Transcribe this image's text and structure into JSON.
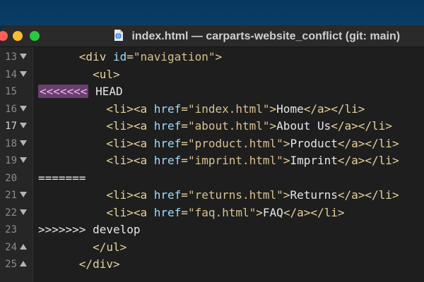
{
  "window": {
    "title": "index.html — carparts-website_conflict (git: main)"
  },
  "editor": {
    "active_line": 17,
    "lines": [
      {
        "n": "13",
        "fold": "down",
        "indent": "      ",
        "tokens": [
          [
            "t",
            "<div "
          ],
          [
            "a",
            "id"
          ],
          [
            "t",
            "="
          ],
          [
            "s",
            "\"navigation\""
          ],
          [
            "t",
            ">"
          ]
        ]
      },
      {
        "n": "14",
        "fold": "down",
        "indent": "        ",
        "tokens": [
          [
            "t",
            "<ul>"
          ]
        ]
      },
      {
        "n": "15",
        "fold": "",
        "indent": "",
        "tokens": [
          [
            "mk",
            "<<<<<<<"
          ],
          [
            "n",
            " HEAD"
          ]
        ]
      },
      {
        "n": "16",
        "fold": "down",
        "indent": "          ",
        "tokens": [
          [
            "t",
            "<li>"
          ],
          [
            "t",
            "<a "
          ],
          [
            "a",
            "href"
          ],
          [
            "t",
            "="
          ],
          [
            "s",
            "\"index.html\""
          ],
          [
            "t",
            ">"
          ],
          [
            "n",
            "Home"
          ],
          [
            "t",
            "</a>"
          ],
          [
            "t",
            "</li>"
          ]
        ]
      },
      {
        "n": "17",
        "fold": "down",
        "indent": "          ",
        "tokens": [
          [
            "t",
            "<li>"
          ],
          [
            "t",
            "<a "
          ],
          [
            "a",
            "href"
          ],
          [
            "t",
            "="
          ],
          [
            "s",
            "\"about.html\""
          ],
          [
            "t",
            ">"
          ],
          [
            "n",
            "About Us"
          ],
          [
            "t",
            "</a>"
          ],
          [
            "t",
            "</li>"
          ]
        ]
      },
      {
        "n": "18",
        "fold": "down",
        "indent": "          ",
        "tokens": [
          [
            "t",
            "<li>"
          ],
          [
            "t",
            "<a "
          ],
          [
            "a",
            "href"
          ],
          [
            "t",
            "="
          ],
          [
            "s",
            "\"product.html\""
          ],
          [
            "t",
            ">"
          ],
          [
            "n",
            "Product"
          ],
          [
            "t",
            "</a>"
          ],
          [
            "t",
            "</li>"
          ]
        ]
      },
      {
        "n": "19",
        "fold": "down",
        "indent": "          ",
        "tokens": [
          [
            "t",
            "<li>"
          ],
          [
            "t",
            "<a "
          ],
          [
            "a",
            "href"
          ],
          [
            "t",
            "="
          ],
          [
            "s",
            "\"imprint.html\""
          ],
          [
            "t",
            ">"
          ],
          [
            "n",
            "Imprint"
          ],
          [
            "t",
            "</a>"
          ],
          [
            "t",
            "</li>"
          ]
        ]
      },
      {
        "n": "20",
        "fold": "",
        "indent": "",
        "tokens": [
          [
            "n",
            "======="
          ]
        ]
      },
      {
        "n": "21",
        "fold": "down",
        "indent": "          ",
        "tokens": [
          [
            "t",
            "<li>"
          ],
          [
            "t",
            "<a "
          ],
          [
            "a",
            "href"
          ],
          [
            "t",
            "="
          ],
          [
            "s",
            "\"returns.html\""
          ],
          [
            "t",
            ">"
          ],
          [
            "n",
            "Returns"
          ],
          [
            "t",
            "</a>"
          ],
          [
            "t",
            "</li>"
          ]
        ]
      },
      {
        "n": "22",
        "fold": "down",
        "indent": "          ",
        "tokens": [
          [
            "t",
            "<li>"
          ],
          [
            "t",
            "<a "
          ],
          [
            "a",
            "href"
          ],
          [
            "t",
            "="
          ],
          [
            "s",
            "\"faq.html\""
          ],
          [
            "t",
            ">"
          ],
          [
            "n",
            "FAQ"
          ],
          [
            "t",
            "</a>"
          ],
          [
            "t",
            "</li>"
          ]
        ]
      },
      {
        "n": "23",
        "fold": "",
        "indent": "",
        "tokens": [
          [
            "n",
            ">>>>>>> develop"
          ]
        ]
      },
      {
        "n": "24",
        "fold": "up",
        "indent": "        ",
        "tokens": [
          [
            "t",
            "</ul>"
          ]
        ]
      },
      {
        "n": "25",
        "fold": "up",
        "indent": "      ",
        "tokens": [
          [
            "t",
            "</div>"
          ]
        ]
      }
    ]
  }
}
